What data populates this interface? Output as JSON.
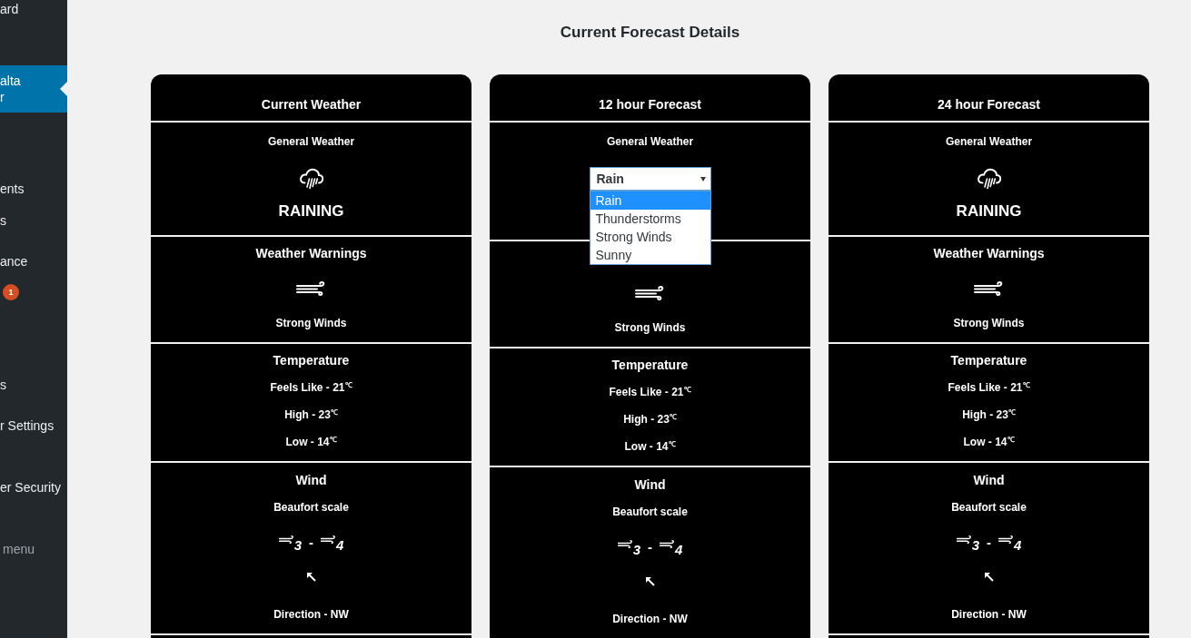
{
  "sidebar": {
    "items": [
      {
        "kind": "link",
        "lines": [
          "ard"
        ],
        "selected": false
      },
      {
        "kind": "link",
        "lines": [
          "alta",
          "r"
        ],
        "selected": true
      },
      {
        "kind": "link",
        "lines": [
          "ents"
        ],
        "selected": false
      },
      {
        "kind": "link",
        "lines": [
          "s"
        ],
        "selected": false
      },
      {
        "kind": "link",
        "lines": [
          "ance"
        ],
        "selected": false
      },
      {
        "kind": "badge",
        "badge": "1",
        "selected": false
      },
      {
        "kind": "link",
        "lines": [
          "s"
        ],
        "selected": false
      },
      {
        "kind": "link",
        "lines": [
          "r Settings"
        ],
        "selected": false
      },
      {
        "kind": "link",
        "lines": [
          "er Security"
        ],
        "selected": false
      },
      {
        "kind": "collapse",
        "lines": [
          "menu"
        ]
      }
    ]
  },
  "page_title": "Current Forecast Details",
  "columns": [
    {
      "title": "Current Weather",
      "general": {
        "kind": "condition",
        "heading": "General Weather",
        "label": "RAINING"
      },
      "warnings": {
        "heading": "Weather Warnings",
        "label": "Strong Winds"
      },
      "temperature": {
        "heading": "Temperature",
        "readings": [
          "Feels Like - 21$^{℃}$",
          "High - 23$^{℃}$",
          "Low - 14$^{℃}$"
        ]
      },
      "wind": {
        "heading": "Wind",
        "scale_label": "Beaufort scale",
        "beaufort_from": "3",
        "range_separator": "-",
        "beaufort_to": "4",
        "direction": "Direction - NW"
      }
    },
    {
      "title": "12 hour Forecast",
      "general": {
        "kind": "select",
        "heading": "General Weather",
        "value": "Rain",
        "expanded": true,
        "options": [
          {
            "label": "Rain",
            "selected": true
          },
          {
            "label": "Thunderstorms",
            "selected": false
          },
          {
            "label": "Strong Winds",
            "selected": false
          },
          {
            "label": "Sunny",
            "selected": false
          }
        ]
      },
      "warnings": {
        "label": "Strong Winds"
      },
      "temperature": {
        "heading": "Temperature",
        "readings": [
          "Feels Like - 21$^{℃}$",
          "High - 23$^{℃}$",
          "Low - 14$^{℃}$"
        ]
      },
      "wind": {
        "heading": "Wind",
        "scale_label": "Beaufort scale",
        "beaufort_from": "3",
        "range_separator": "-",
        "beaufort_to": "4",
        "direction": "Direction - NW"
      }
    },
    {
      "title": "24 hour Forecast",
      "general": {
        "kind": "condition",
        "heading": "General Weather",
        "label": "RAINING"
      },
      "warnings": {
        "heading": "Weather Warnings",
        "label": "Strong Winds"
      },
      "temperature": {
        "heading": "Temperature",
        "readings": [
          "Feels Like - 21$^{℃}$",
          "High - 23$^{℃}$",
          "Low - 14$^{℃}$"
        ]
      },
      "wind": {
        "heading": "Wind",
        "scale_label": "Beaufort scale",
        "beaufort_from": "3",
        "range_separator": "-",
        "beaufort_to": "4",
        "direction": "Direction - NW"
      }
    }
  ]
}
